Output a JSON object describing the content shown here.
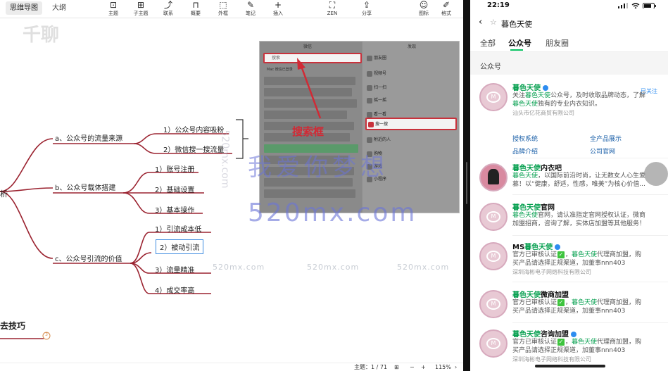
{
  "left_app": {
    "tabs": [
      {
        "label": "思维导图",
        "active": true
      },
      {
        "label": "大纲",
        "active": false
      }
    ],
    "tools": [
      {
        "name": "topic",
        "label": "主题",
        "icon": "topic-icon"
      },
      {
        "name": "subtopic",
        "label": "子主题",
        "icon": "subtopic-icon"
      },
      {
        "name": "relation",
        "label": "联系",
        "icon": "relation-icon"
      },
      {
        "name": "summary",
        "label": "概要",
        "icon": "summary-icon"
      },
      {
        "name": "boundary",
        "label": "外框",
        "icon": "boundary-icon"
      },
      {
        "name": "note",
        "label": "笔记",
        "icon": "note-icon"
      },
      {
        "name": "insert",
        "label": "插入",
        "icon": "plus-icon"
      },
      {
        "name": "zen",
        "label": "ZEN",
        "icon": "zen-icon"
      },
      {
        "name": "share",
        "label": "分享",
        "icon": "share-icon"
      },
      {
        "name": "icon",
        "label": "图标",
        "icon": "smiley-icon"
      },
      {
        "name": "style",
        "label": "格式",
        "icon": "brush-icon"
      }
    ],
    "mindmap": {
      "root_partial": "析",
      "bottom_partial": "去技巧",
      "bottom_badge": "3",
      "branches": [
        {
          "label": "a、公众号的流量来源",
          "children": [
            "1）公众号内容吸粉",
            "2）微信搜一搜流量"
          ]
        },
        {
          "label": "b、公众号载体搭建",
          "children": [
            "1）账号注册",
            "2）基础设置",
            "3）基本操作"
          ]
        },
        {
          "label": "c、公众号引流的价值",
          "children": [
            "1）引流成本低",
            "2）被动引流",
            "3）流量精准",
            "4）成交率高"
          ]
        }
      ],
      "selected_node": "2）被动引流"
    },
    "inset": {
      "left_header": "微信",
      "right_header": "发现",
      "search_placeholder": "搜索",
      "mac_row": "Mac 微信已登录",
      "right_items": [
        "朋友圈",
        "视频号",
        "扫一扫",
        "摇一摇",
        "看一看",
        "搜一搜",
        "附近的人",
        "购物",
        "游戏",
        "小程序"
      ]
    },
    "callout": "搜索框",
    "watermarks": {
      "logo": "千聊",
      "big": "我爱你梦想",
      "url": "520mx.com",
      "small": "520mx.com"
    },
    "status": {
      "topic_count": "主题：1 / 71",
      "zoom": "115%",
      "zoom_minus": "−",
      "zoom_plus": "+"
    }
  },
  "phone": {
    "time": "22:19",
    "title": "暮色天使",
    "tabs": [
      {
        "label": "全部",
        "active": false
      },
      {
        "label": "公众号",
        "active": true
      },
      {
        "label": "朋友圈",
        "active": false
      }
    ],
    "section_label": "公众号",
    "followed": "已关注",
    "accounts": [
      {
        "name_hl": "暮色天使",
        "name_rest": "",
        "verified": true,
        "line1_pre": "关注",
        "line1_hl": "暮色天使",
        "line1_post": "公众号，及时收取品牌动态，了解",
        "line2_hl": "暮色天使",
        "line2_post": "独有的专业内衣知识。",
        "company": "汕头市亿花商贸有限公司",
        "links": [
          "授权系统",
          "全产品展示",
          "品牌介绍",
          "公司官网"
        ]
      },
      {
        "name_hl": "暮色天使",
        "name_rest": "内衣吧",
        "verified": false,
        "line1_pre": "",
        "line1_hl": "暮色天使",
        "line1_post": "，以国际前沿时尚，让无数女人心生爱",
        "line2_hl": "",
        "line2_post": "慕！以“健康，舒适，性感，唯美”为核心价值...",
        "company": ""
      },
      {
        "name_hl": "暮色天使",
        "name_rest": "官网",
        "verified": false,
        "line1_pre": "",
        "line1_hl": "暮色天使",
        "line1_post": "官网，请认准指定官网授权认证，微商",
        "line2_hl": "",
        "line2_post": "加盟招商，咨询了解，实体店加盟等其他服务！",
        "company": ""
      },
      {
        "name_hl": "MS",
        "name_rest": "暮色天使",
        "verified": true,
        "line1_pre": "官方已审核认证",
        "line1_hl": "暮色天使",
        "line1_post": "代理商加盟，购",
        "line2_hl": "",
        "line2_post": "买产品请选择正规渠道，加董事nnn403",
        "company": "深圳海彬电子网络科技有限公司"
      },
      {
        "name_hl": "暮色天使",
        "name_rest": "微商加盟",
        "verified": false,
        "line1_pre": "官方已审核认证",
        "line1_hl": "暮色天使",
        "line1_post": "代理商加盟，购",
        "line2_hl": "",
        "line2_post": "买产品请选择正规渠道，加董事nnn403",
        "company": ""
      },
      {
        "name_hl": "暮色天使",
        "name_rest": "咨询加盟",
        "verified": true,
        "line1_pre": "官方已审核认证",
        "line1_hl": "暮色天使",
        "line1_post": "代理商加盟，购",
        "line2_hl": "",
        "line2_post": "买产品请选择正规渠道，加董事nnn403",
        "company": "深圳海彬电子网络科技有限公司"
      }
    ]
  },
  "colors": {
    "branch_red": "#9b2330",
    "accent_green": "#07a050",
    "verify_blue": "#2d8cf0",
    "callout_red": "#d12a35",
    "selection_blue": "#3d8be0"
  }
}
